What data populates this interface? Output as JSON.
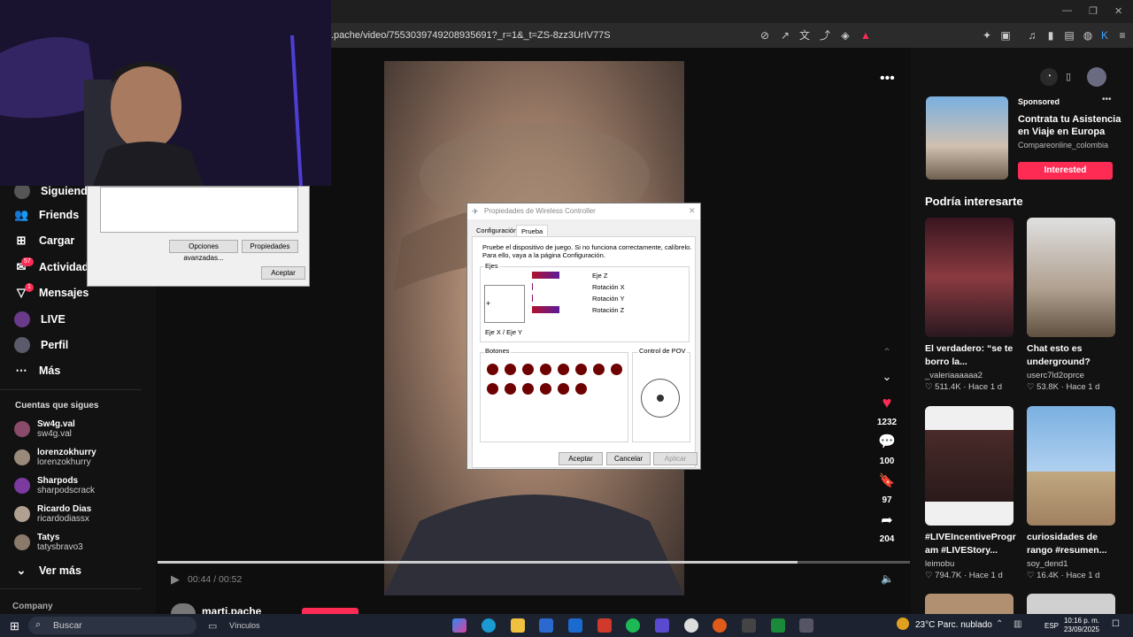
{
  "browser": {
    "url": ".pache/video/7553039749208935691?_r=1&_t=ZS-8zz3UrIV77S"
  },
  "sidebar": {
    "items": [
      {
        "label": "Siguiendo",
        "icon": "following-icon"
      },
      {
        "label": "Friends",
        "icon": "friends-icon"
      },
      {
        "label": "Cargar",
        "icon": "upload-icon"
      },
      {
        "label": "Actividad",
        "icon": "activity-icon",
        "badge": "57"
      },
      {
        "label": "Mensajes",
        "icon": "messages-icon",
        "badge": "1"
      },
      {
        "label": "LIVE",
        "icon": "live-icon"
      },
      {
        "label": "Perfil",
        "icon": "profile-icon"
      },
      {
        "label": "Más",
        "icon": "more-icon"
      }
    ],
    "following_header": "Cuentas que sigues",
    "following": [
      {
        "name": "Sw4g.val",
        "handle": "sw4g.val"
      },
      {
        "name": "lorenzokhurry",
        "handle": "lorenzokhurry"
      },
      {
        "name": "Sharpods",
        "handle": "sharpodscrack"
      },
      {
        "name": "Ricardo Dias",
        "handle": "ricardodiassx"
      },
      {
        "name": "Tatys",
        "handle": "tatysbravo3"
      }
    ],
    "see_more": "Ver más",
    "company": "Company"
  },
  "small_dialog": {
    "advanced_button": "Opciones avanzadas...",
    "properties_button": "Propiedades",
    "accept_button": "Aceptar"
  },
  "video": {
    "time": "00:44 / 00:52",
    "progress": 0.85,
    "author": "marti.pache",
    "likes": "1232",
    "comments": "100",
    "saves": "97",
    "shares": "204"
  },
  "properties_dialog": {
    "title": "Propiedades de Wireless Controller",
    "tabs": [
      "Configuración",
      "Prueba"
    ],
    "active_tab": "Prueba",
    "instructions_1": "Pruebe el dispositivo de juego. Si no funciona correctamente, calíbrelo.",
    "instructions_2": "Para ello, vaya a la página Configuración.",
    "axes_label": "Ejes",
    "xy_label": "Eje X / Eje Y",
    "axes": [
      {
        "label": "Eje Z",
        "level": 0.6
      },
      {
        "label": "Rotación X",
        "level": 0.02
      },
      {
        "label": "Rotación Y",
        "level": 0.02
      },
      {
        "label": "Rotación Z",
        "level": 0.6
      }
    ],
    "buttons_label": "Botones",
    "buttons_count": 14,
    "pov_label": "Control de POV",
    "accept": "Aceptar",
    "cancel": "Cancelar",
    "apply": "Aplicar"
  },
  "right": {
    "sponsored": "Sponsored",
    "ad_title": "Contrata tu Asistencia en Viaje en Europa",
    "ad_title_l1": "Contrata tu Asistencia",
    "ad_title_l2": "en Viaje en Europa",
    "ad_user": "Compareonline_colombia",
    "ad_button": "Interested",
    "header": "Podría interesarte",
    "cards": [
      {
        "title_l1": "El verdadero: “se te",
        "title_l2": "borro la...",
        "user": "_valeriaaaaaa2",
        "likes": "511.4K",
        "age": "Hace 1 d"
      },
      {
        "title_l1": "Chat esto es",
        "title_l2": "underground?",
        "user": "userc7ld2oprce",
        "likes": "53.8K",
        "age": "Hace 1 d"
      },
      {
        "title_l1": "#LIVEIncentiveProgr",
        "title_l2": "am #LIVEStory...",
        "user": "leimobu",
        "likes": "794.7K",
        "age": "Hace 1 d"
      },
      {
        "title_l1": "curiosidades de",
        "title_l2": "rango #resumen...",
        "user": "soy_dend1",
        "likes": "16.4K",
        "age": "Hace 1 d"
      }
    ]
  },
  "taskbar": {
    "search": "Buscar",
    "links": "Vínculos",
    "weather": "23°C  Parc. nublado",
    "lang": "ESP",
    "time": "10:16 p. m.",
    "date": "23/09/2025"
  },
  "colors": {
    "accent": "#fe2c55",
    "dialog_button_dot": "#6e0000"
  }
}
